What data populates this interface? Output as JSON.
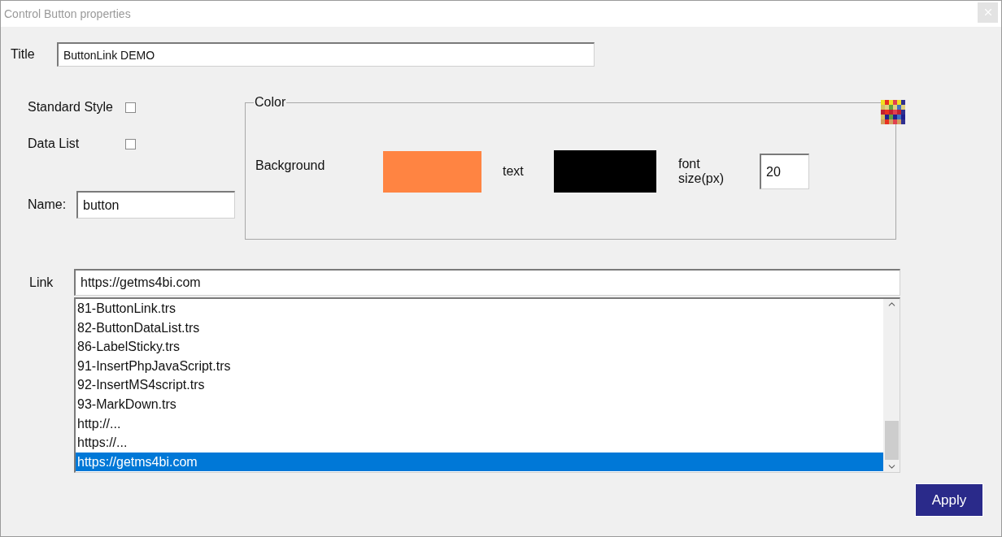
{
  "window": {
    "title": "Control Button properties"
  },
  "title_field": {
    "label": "Title",
    "value": "ButtonLink DEMO"
  },
  "checkboxes": [
    {
      "label": "Standard Style",
      "checked": false
    },
    {
      "label": "Data List",
      "checked": false
    }
  ],
  "name_field": {
    "label": "Name:",
    "value": "button"
  },
  "color_group": {
    "legend": "Color",
    "swatches": [
      {
        "label": "Background",
        "color": "#ff8442"
      },
      {
        "label": "text",
        "color": "#000000"
      }
    ],
    "font_size": {
      "label": "font size(px)",
      "value": "20"
    }
  },
  "link_field": {
    "label": "Link",
    "value": "https://getms4bi.com"
  },
  "link_list": [
    {
      "text": "81-ButtonLink.trs",
      "selected": false
    },
    {
      "text": "82-ButtonDataList.trs",
      "selected": false
    },
    {
      "text": "86-LabelSticky.trs",
      "selected": false
    },
    {
      "text": "91-InsertPhpJavaScript.trs",
      "selected": false
    },
    {
      "text": "92-InsertMS4script.trs",
      "selected": false
    },
    {
      "text": "93-MarkDown.trs",
      "selected": false
    },
    {
      "text": "http://...",
      "selected": false
    },
    {
      "text": "https://...",
      "selected": false
    },
    {
      "text": "https://getms4bi.com",
      "selected": true
    }
  ],
  "apply_button": {
    "label": "Apply"
  }
}
